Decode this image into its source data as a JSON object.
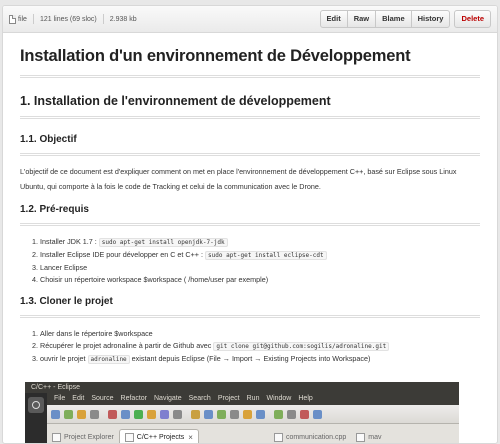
{
  "filebar": {
    "file_label": "file",
    "lines": "121 lines (69 sloc)",
    "size": "2.938 kb",
    "buttons": {
      "edit": "Edit",
      "raw": "Raw",
      "blame": "Blame",
      "history": "History",
      "delete": "Delete"
    }
  },
  "doc": {
    "title": "Installation d'un environnement de Développement",
    "section1": "1. Installation de l'environnement de développement",
    "sub_objectif": "1.1. Objectif",
    "objectif_text": "L'objectif de ce document est d'expliquer comment on met en place l'environnement de développement C++, basé sur Eclipse sous Linux Ubuntu, qui comporte à la fois le code de Tracking et celui de la communication avec le Drone.",
    "sub_prereq": "1.2. Pré-requis",
    "prereq": {
      "i1_text": "Installer JDK 1.7 :",
      "i1_code": "sudo apt-get install openjdk-7-jdk",
      "i2_text": "Installer Eclipse IDE pour développer en C et C++ :",
      "i2_code": "sudo apt-get install eclipse-cdt",
      "i3_text": "Lancer Eclipse",
      "i4_text": "Choisir un répertoire workspace $workspace ( /home/user par exemple)"
    },
    "sub_clone": "1.3. Cloner le projet",
    "clone": {
      "i1_text": "Aller dans le répertoire $workspace",
      "i2_text": "Récupérer le projet adronaline à partir de Github avec",
      "i2_code": "git clone git@github.com:sogilis/adronaline.git",
      "i3_pre": "ouvrir le projet",
      "i3_code": "adronaline",
      "i3_post": "existant depuis Eclipse (File → Import → Existing Projects into Workspace)"
    }
  },
  "eclipse": {
    "title": "C/C++ - Eclipse",
    "menu": [
      "File",
      "Edit",
      "Source",
      "Refactor",
      "Navigate",
      "Search",
      "Project",
      "Run",
      "Window",
      "Help"
    ],
    "tabs": {
      "project_explorer": "Project Explorer",
      "cpp_projects": "C/C++ Projects",
      "close": "×",
      "file_tab": "communication.cpp",
      "more_tab": "mav"
    },
    "toolbar_colors": [
      "#6a8fc7",
      "#7fae5a",
      "#d9a23a",
      "#8a8a8a",
      "#c15a5a",
      "#6a8fc7",
      "#4caf50",
      "#d9a23a",
      "#7f7fcf",
      "#8a8a8a",
      "#c9a040",
      "#6a8fc7",
      "#7fae5a",
      "#8a8a8a",
      "#d9a23a",
      "#6a8fc7",
      "#7fae5a",
      "#8a8a8a",
      "#c15a5a",
      "#6a8fc7"
    ]
  }
}
